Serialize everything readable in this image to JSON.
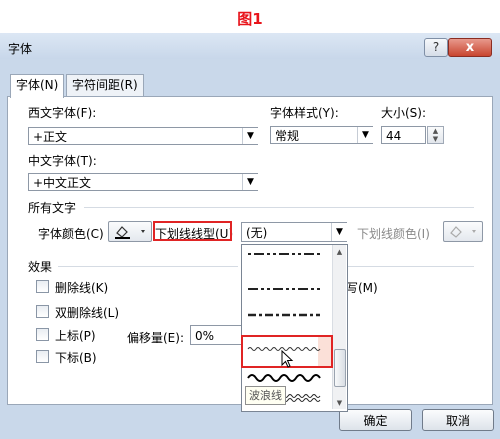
{
  "figure_title": "图1",
  "window": {
    "title": "字体",
    "help": "?",
    "close": "x"
  },
  "tabs": [
    {
      "label": "字体(N)"
    },
    {
      "label": "字符间距(R)"
    }
  ],
  "western_font": {
    "label": "西文字体(F):",
    "value": "+正文"
  },
  "font_style": {
    "label": "字体样式(Y):",
    "value": "常规"
  },
  "size": {
    "label": "大小(S):",
    "value": "44"
  },
  "chinese_font": {
    "label": "中文字体(T):",
    "value": "+中文正文"
  },
  "all_text": {
    "section": "所有文字",
    "font_color_label": "字体颜色(C)",
    "underline_type_label": "下划线线型(U)",
    "underline_type_value": "(无)",
    "underline_color_label": "下划线颜色(I)"
  },
  "effects": {
    "section": "效果",
    "strikethrough": "删除线(K)",
    "double_strikethrough": "双删除线(L)",
    "superscript": "上标(P)",
    "subscript": "下标(B)",
    "offset_label": "偏移量(E):",
    "offset_value": "0%",
    "partial_right_label": "写(M)"
  },
  "dropdown": {
    "tooltip": "波浪线"
  },
  "buttons": {
    "ok": "确定",
    "cancel": "取消"
  },
  "colors": {
    "accent_red": "#e02424",
    "title_red": "#e8141b",
    "dialog_bg": "#c9d8ea"
  }
}
